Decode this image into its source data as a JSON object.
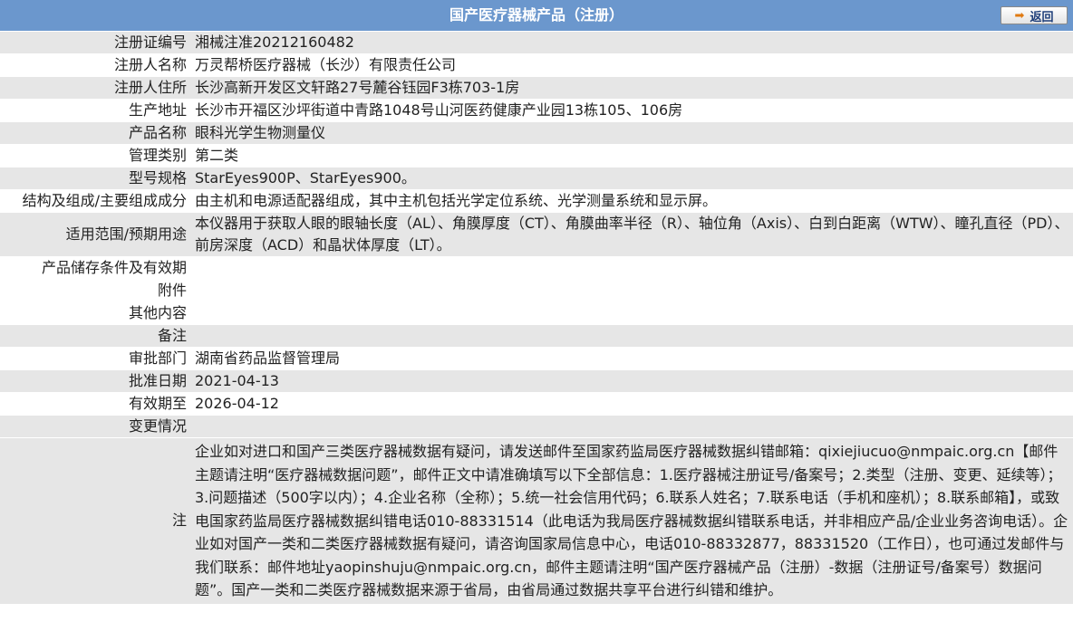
{
  "header": {
    "title": "国产医疗器械产品（注册）",
    "back_label": "返回"
  },
  "rows": [
    {
      "label": "注册证编号",
      "value": "湘械注准20212160482"
    },
    {
      "label": "注册人名称",
      "value": "万灵帮桥医疗器械（长沙）有限责任公司"
    },
    {
      "label": "注册人住所",
      "value": "长沙高新开发区文轩路27号麓谷钰园F3栋703-1房"
    },
    {
      "label": "生产地址",
      "value": "长沙市开福区沙坪街道中青路1048号山河医药健康产业园13栋105、106房"
    },
    {
      "label": "产品名称",
      "value": "眼科光学生物测量仪"
    },
    {
      "label": "管理类别",
      "value": "第二类"
    },
    {
      "label": "型号规格",
      "value": "StarEyes900P、StarEyes900。"
    },
    {
      "label": "结构及组成/主要组成成分",
      "value": "由主机和电源适配器组成，其中主机包括光学定位系统、光学测量系统和显示屏。"
    },
    {
      "label": "适用范围/预期用途",
      "value": "本仪器用于获取人眼的眼轴长度（AL）、角膜厚度（CT）、角膜曲率半径（R）、轴位角（Axis）、白到白距离（WTW）、瞳孔直径（PD）、前房深度（ACD）和晶状体厚度（LT）。"
    },
    {
      "label": "产品储存条件及有效期",
      "value": ""
    },
    {
      "label": "附件",
      "value": ""
    },
    {
      "label": "其他内容",
      "value": ""
    },
    {
      "label": "备注",
      "value": ""
    },
    {
      "label": "审批部门",
      "value": "湖南省药品监督管理局"
    },
    {
      "label": "批准日期",
      "value": "2021-04-13"
    },
    {
      "label": "有效期至",
      "value": "2026-04-12"
    },
    {
      "label": "变更情况",
      "value": ""
    }
  ],
  "note": {
    "label": "注",
    "text": "企业如对进口和国产三类医疗器械数据有疑问，请发送邮件至国家药监局医疗器械数据纠错邮箱：qixiejiucuo@nmpaic.org.cn【邮件主题请注明“医疗器械数据问题”，邮件正文中请准确填写以下全部信息：1.医疗器械注册证号/备案号；2.类型（注册、变更、延续等）；3.问题描述（500字以内）；4.企业名称（全称）；5.统一社会信用代码；6.联系人姓名；7.联系电话（手机和座机）；8.联系邮箱】，或致电国家药监局医疗器械数据纠错电话010-88331514（此电话为我局医疗器械数据纠错联系电话，并非相应产品/企业业务咨询电话）。企业如对国产一类和二类医疗器械数据有疑问，请咨询国家局信息中心，电话010-88332877，88331520（工作日），也可通过发邮件与我们联系：邮件地址yaopinshuju@nmpaic.org.cn，邮件主题请注明“国产医疗器械产品（注册）-数据（注册证号/备案号）数据问题”。国产一类和二类医疗器械数据来源于省局，由省局通过数据共享平台进行纠错和维护。"
  },
  "colors": {
    "header_bg": "#6b97cd",
    "row_alt_bg": "#e6e6e6",
    "back_arrow": "#e07a12"
  }
}
